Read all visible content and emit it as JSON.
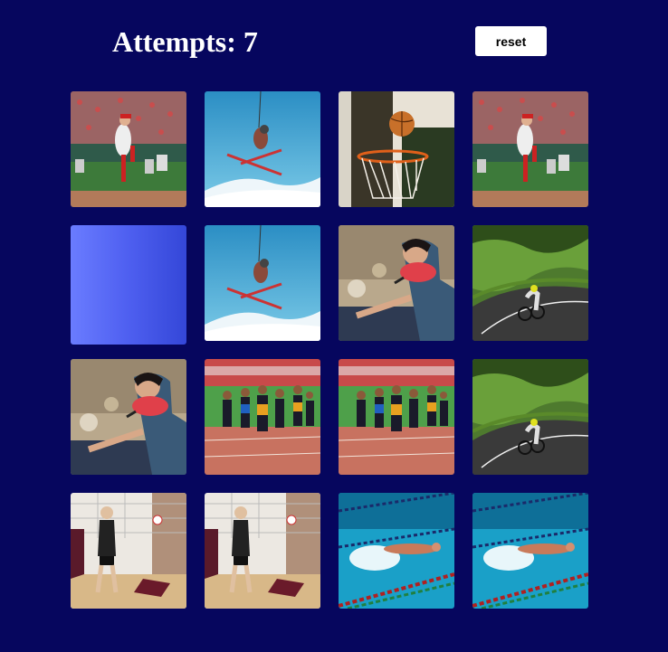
{
  "header": {
    "attempts_label": "Attempts: 7",
    "reset_label": "reset"
  },
  "board": {
    "rows": [
      [
        {
          "state": "revealed",
          "image": "baseball-pitcher"
        },
        {
          "state": "revealed",
          "image": "skier-jump"
        },
        {
          "state": "revealed",
          "image": "basketball-hoop"
        },
        {
          "state": "revealed",
          "image": "baseball-pitcher"
        }
      ],
      [
        {
          "state": "hidden",
          "image": "card-back"
        },
        {
          "state": "revealed",
          "image": "skier-jump"
        },
        {
          "state": "revealed",
          "image": "table-tennis-player"
        },
        {
          "state": "revealed",
          "image": "road-cyclist"
        }
      ],
      [
        {
          "state": "revealed",
          "image": "table-tennis-player"
        },
        {
          "state": "revealed",
          "image": "sprinters-track"
        },
        {
          "state": "revealed",
          "image": "sprinters-track"
        },
        {
          "state": "revealed",
          "image": "road-cyclist"
        }
      ],
      [
        {
          "state": "revealed",
          "image": "volleyball-players"
        },
        {
          "state": "revealed",
          "image": "volleyball-players"
        },
        {
          "state": "revealed",
          "image": "swimmer-pool"
        },
        {
          "state": "revealed",
          "image": "swimmer-pool"
        }
      ]
    ]
  },
  "colors": {
    "background": "#06065e",
    "card_back_start": "#6a7cff",
    "card_back_end": "#3447d8",
    "button_bg": "#ffffff",
    "title_text": "#ffffff"
  }
}
